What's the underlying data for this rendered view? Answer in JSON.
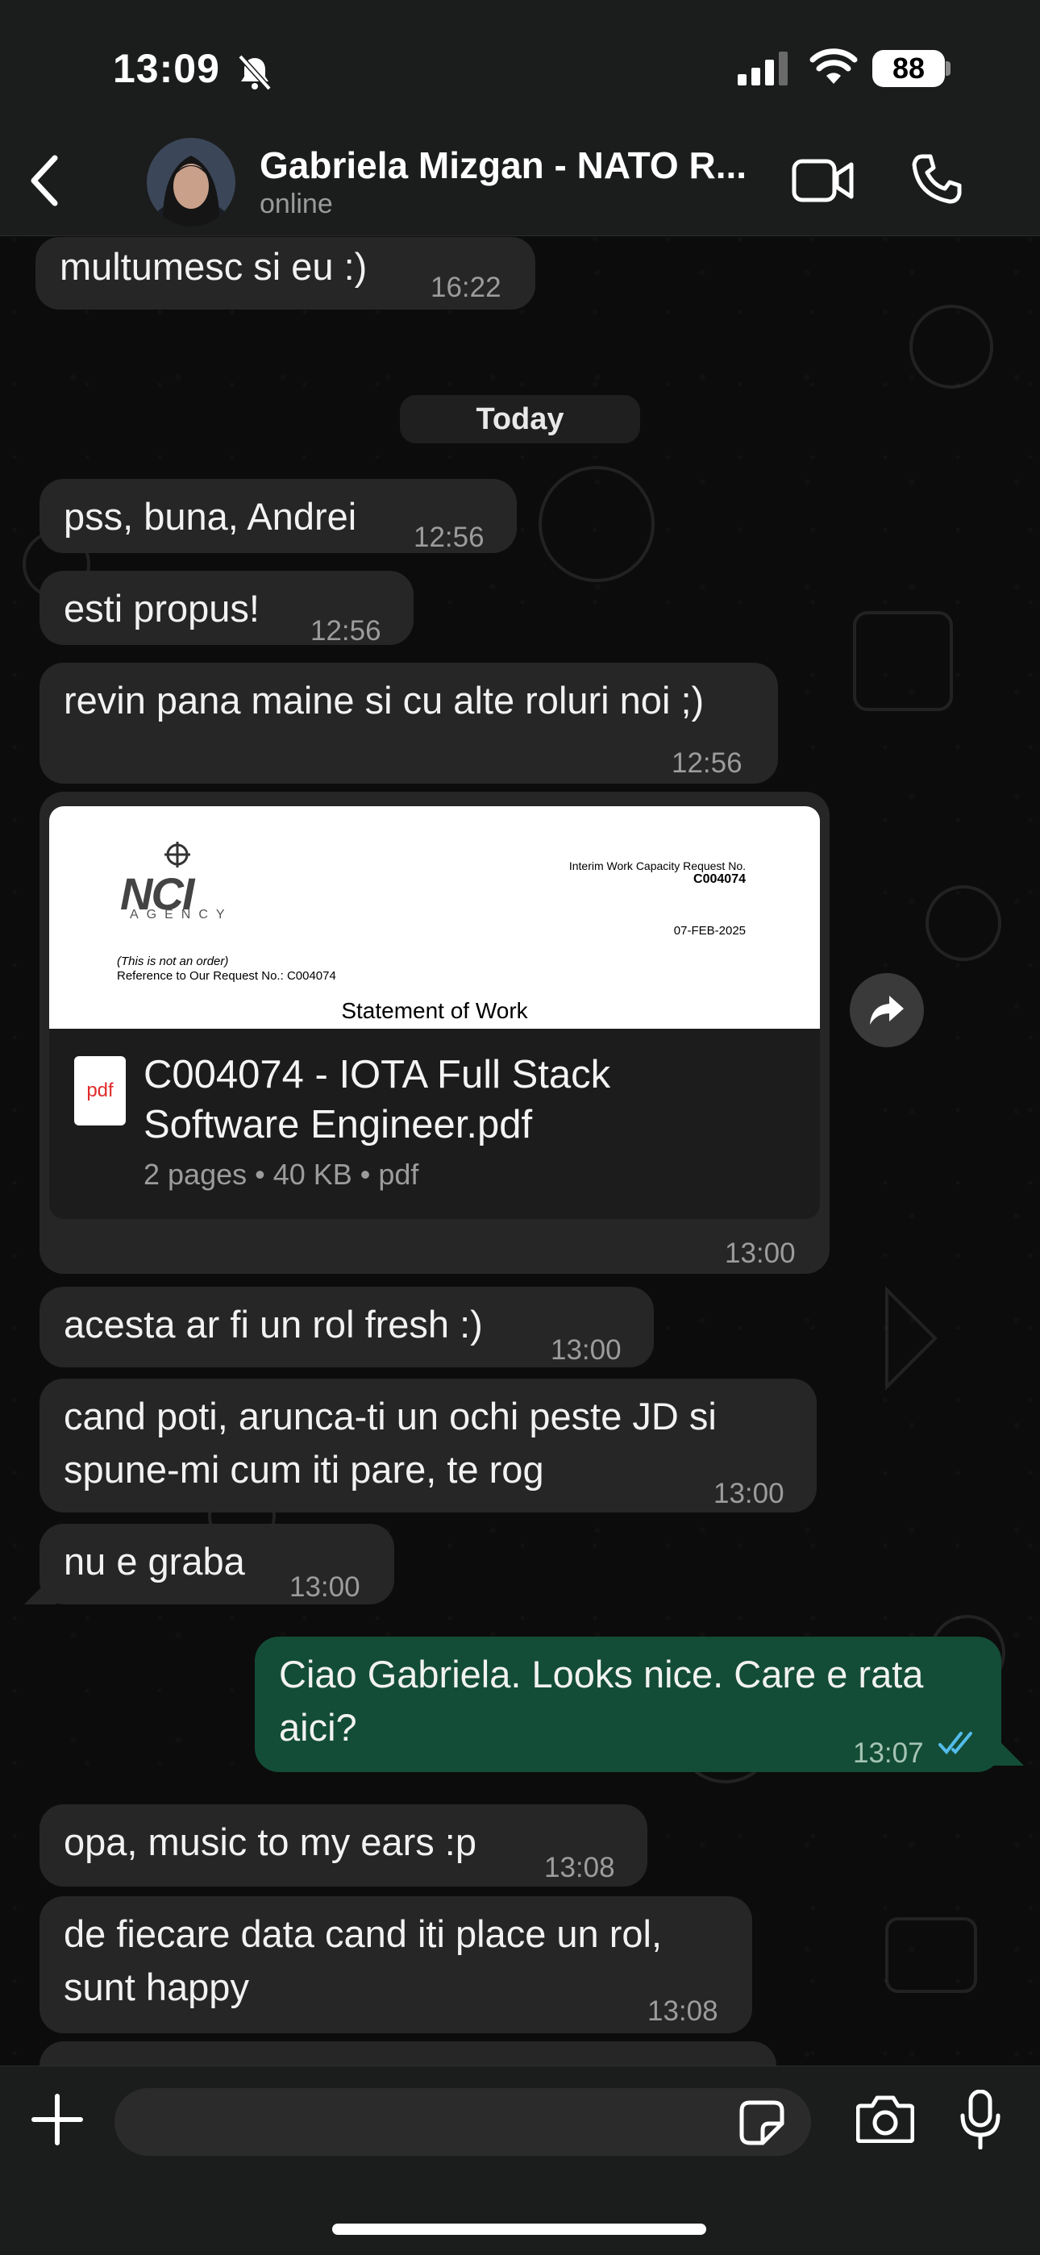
{
  "status_bar": {
    "time": "13:09",
    "battery": "88"
  },
  "header": {
    "contact_name": "Gabriela Mizgan - NATO R...",
    "contact_status": "online"
  },
  "date_divider": "Today",
  "messages": [
    {
      "text": "multumesc si eu :)",
      "time": "16:22"
    },
    {
      "text": "pss, buna, Andrei",
      "time": "12:56"
    },
    {
      "text": "esti propus!",
      "time": "12:56"
    },
    {
      "text": "revin pana maine si cu alte roluri noi ;)",
      "time": "12:56"
    },
    {
      "text": "acesta ar fi un rol fresh :)",
      "time": "13:00"
    },
    {
      "line1": "cand poti, arunca-ti un ochi peste JD si",
      "line2": "spune-mi cum iti pare, te rog",
      "time": "13:00"
    },
    {
      "text": "nu e graba",
      "time": "13:00"
    },
    {
      "line1": "Ciao Gabriela. Looks nice. Care e rata",
      "line2": "aici?",
      "time": "13:07",
      "outgoing": true
    },
    {
      "text": "opa, music to my ears :p",
      "time": "13:08"
    },
    {
      "line1": "de fiecare data cand iti place un rol,",
      "line2": "sunt happy",
      "time": "13:08"
    }
  ],
  "document": {
    "preview": {
      "logo_text": "NCI",
      "logo_sub": "AGENCY",
      "request_label": "Interim Work Capacity Request No.",
      "request_no": "C004074",
      "date": "07-FEB-2025",
      "note": "(This is not an order)",
      "reference": "Reference to Our Request No.: C004074",
      "heading": "Statement of Work"
    },
    "icon_label": "pdf",
    "name_line1": "C004074 - IOTA Full Stack",
    "name_line2": "Software Engineer.pdf",
    "meta": "2 pages • 40 KB • pdf",
    "time": "13:00"
  },
  "colors": {
    "incoming_bubble": "#262626",
    "outgoing_bubble": "#144d37",
    "read_ticks": "#53bdeb"
  },
  "icons": [
    "bell-slash-icon",
    "signal-icon",
    "wifi-icon",
    "back-icon",
    "video-call-icon",
    "phone-icon",
    "forward-icon",
    "plus-icon",
    "sticker-icon",
    "camera-icon",
    "mic-icon",
    "double-check-icon"
  ]
}
